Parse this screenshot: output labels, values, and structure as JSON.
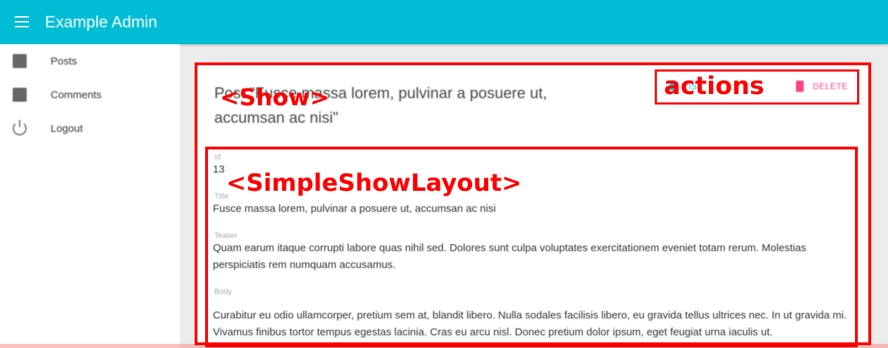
{
  "appbar": {
    "title": "Example Admin"
  },
  "sidebar": {
    "items": [
      {
        "label": "Posts",
        "icon": "book-icon"
      },
      {
        "label": "Comments",
        "icon": "comment-icon"
      },
      {
        "label": "Logout",
        "icon": "power-icon"
      }
    ]
  },
  "show": {
    "title": "Post \"Fusce massa lorem, pulvinar a posuere ut, accumsan ac nisi\"",
    "actions": {
      "list_label": "LIST",
      "delete_label": "DELETE"
    },
    "fields": [
      {
        "label": "Id",
        "value": "13"
      },
      {
        "label": "Title",
        "value": "Fusce massa lorem, pulvinar a posuere ut, accumsan ac nisi"
      },
      {
        "label": "Teaser",
        "value": "Quam earum itaque corrupti labore quas nihil sed. Dolores sunt culpa voluptates exercitationem eveniet totam rerum. Molestias perspiciatis rem numquam accusamus."
      },
      {
        "label": "Body",
        "value": "Curabitur eu odio ullamcorper, pretium sem at, blandit libero. Nulla sodales facilisis libero, eu gravida tellus ultrices nec. In ut gravida mi. Vivamus finibus tortor tempus egestas lacinia. Cras eu arcu nisl. Donec pretium dolor ipsum, eget feugiat urna iaculis ut."
      }
    ]
  },
  "annotations": {
    "show": "<Show>",
    "actions": "actions",
    "layout": "<SimpleShowLayout>"
  },
  "colors": {
    "primary": "#00bcd4",
    "accent": "#ff4081",
    "annotation": "#ff0000"
  }
}
